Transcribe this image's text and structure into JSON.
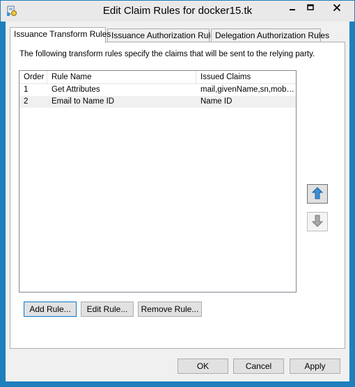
{
  "window": {
    "title": "Edit Claim Rules for docker15.tk"
  },
  "tabs": [
    {
      "label": "Issuance Transform Rules",
      "active": true
    },
    {
      "label": "Issuance Authorization Rules",
      "active": false
    },
    {
      "label": "Delegation Authorization Rules",
      "active": false
    }
  ],
  "panel": {
    "description": "The following transform rules specify the claims that will be sent to the relying party."
  },
  "rules_table": {
    "columns": [
      "Order",
      "Rule Name",
      "Issued Claims"
    ],
    "rows": [
      {
        "order": "1",
        "name": "Get Attributes",
        "claims": "mail,givenName,sn,mobil..."
      },
      {
        "order": "2",
        "name": "Email to Name ID",
        "claims": "Name ID"
      }
    ]
  },
  "rule_buttons": {
    "add": "Add Rule...",
    "edit": "Edit Rule...",
    "remove": "Remove Rule..."
  },
  "dialog_buttons": {
    "ok": "OK",
    "cancel": "Cancel",
    "apply": "Apply"
  },
  "icons": {
    "app": "claim-rules-app-icon",
    "move_up": "arrow-up-icon",
    "move_down": "arrow-down-icon"
  },
  "colors": {
    "accent": "#1e7fbd",
    "arrow_up": "#3c8fd6",
    "arrow_down": "#9a9a9a"
  }
}
